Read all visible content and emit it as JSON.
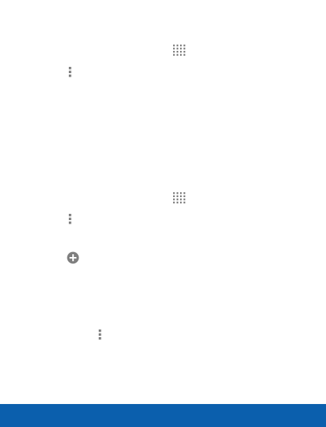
{
  "icons": {
    "apps_icon_1": "apps-grid-icon",
    "menu_icon_1": "overflow-menu-icon",
    "apps_icon_2": "apps-grid-icon",
    "menu_icon_2": "overflow-menu-icon",
    "add_icon": "add-circle-icon",
    "menu_icon_3": "overflow-menu-icon"
  },
  "footer": {
    "text": ""
  },
  "colors": {
    "icon": "#888888",
    "footer": "#0b5fad"
  }
}
